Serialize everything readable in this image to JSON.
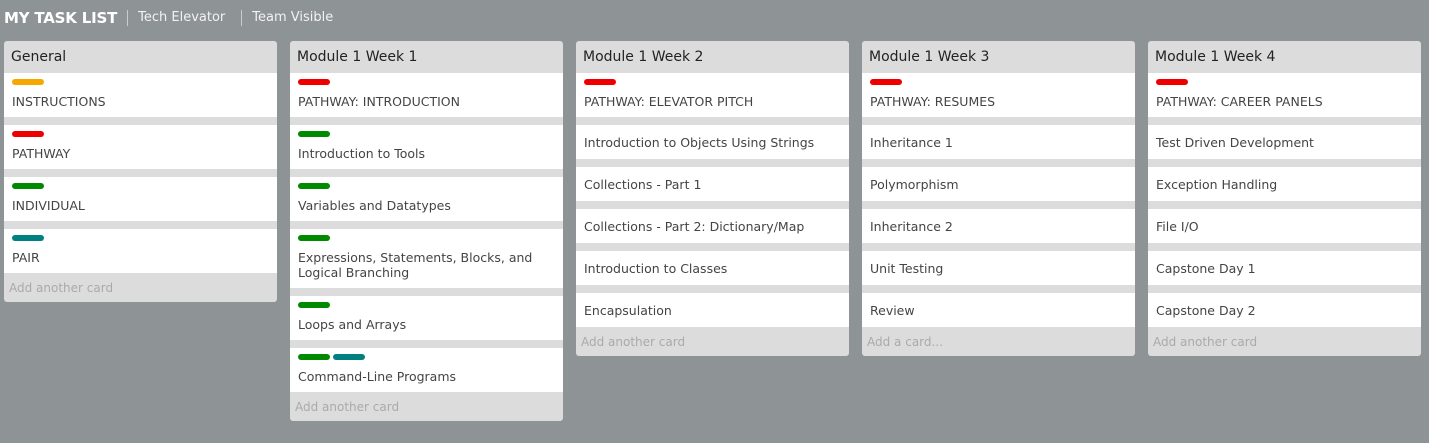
{
  "header": {
    "title": "MY TASK LIST",
    "links": [
      "Tech Elevator",
      "Team Visible"
    ]
  },
  "colors": {
    "yellow": "#f5a800",
    "red": "#ee0000",
    "green": "#008a00",
    "teal": "#008080"
  },
  "lists": [
    {
      "title": "General",
      "add_label": "Add another card",
      "cards": [
        {
          "text": "INSTRUCTIONS",
          "labels": [
            "yellow"
          ]
        },
        {
          "text": "PATHWAY",
          "labels": [
            "red"
          ]
        },
        {
          "text": "INDIVIDUAL",
          "labels": [
            "green"
          ]
        },
        {
          "text": "PAIR",
          "labels": [
            "teal"
          ]
        }
      ]
    },
    {
      "title": "Module 1 Week 1",
      "add_label": "Add another card",
      "cards": [
        {
          "text": "PATHWAY: INTRODUCTION",
          "labels": [
            "red"
          ]
        },
        {
          "text": "Introduction to Tools",
          "labels": [
            "green"
          ]
        },
        {
          "text": "Variables and Datatypes",
          "labels": [
            "green"
          ]
        },
        {
          "text": "Expressions, Statements, Blocks, and Logical Branching",
          "labels": [
            "green"
          ]
        },
        {
          "text": "Loops and Arrays",
          "labels": [
            "green"
          ]
        },
        {
          "text": "Command-Line Programs",
          "labels": [
            "green",
            "teal"
          ]
        }
      ]
    },
    {
      "title": "Module 1 Week 2",
      "add_label": "Add another card",
      "cards": [
        {
          "text": "PATHWAY: ELEVATOR PITCH",
          "labels": [
            "red"
          ]
        },
        {
          "text": "Introduction to Objects Using Strings",
          "labels": []
        },
        {
          "text": "Collections - Part 1",
          "labels": []
        },
        {
          "text": "Collections - Part 2: Dictionary/Map",
          "labels": []
        },
        {
          "text": "Introduction to Classes",
          "labels": []
        },
        {
          "text": "Encapsulation",
          "labels": []
        }
      ]
    },
    {
      "title": "Module 1 Week 3",
      "add_label": "Add a card...",
      "cards": [
        {
          "text": "PATHWAY: RESUMES",
          "labels": [
            "red"
          ]
        },
        {
          "text": "Inheritance 1",
          "labels": []
        },
        {
          "text": "Polymorphism",
          "labels": []
        },
        {
          "text": "Inheritance 2",
          "labels": []
        },
        {
          "text": "Unit Testing",
          "labels": []
        },
        {
          "text": "Review",
          "labels": []
        }
      ]
    },
    {
      "title": "Module 1 Week 4",
      "add_label": "Add another card",
      "cards": [
        {
          "text": "PATHWAY: CAREER PANELS",
          "labels": [
            "red"
          ]
        },
        {
          "text": "Test Driven Development",
          "labels": []
        },
        {
          "text": "Exception Handling",
          "labels": []
        },
        {
          "text": "File I/O",
          "labels": []
        },
        {
          "text": "Capstone Day 1",
          "labels": []
        },
        {
          "text": "Capstone Day 2",
          "labels": []
        }
      ]
    }
  ]
}
